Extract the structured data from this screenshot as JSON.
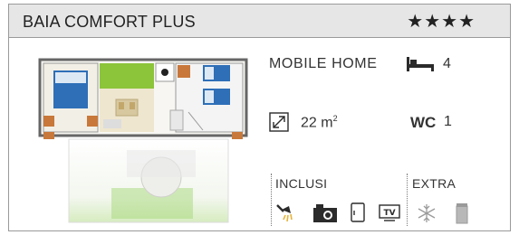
{
  "header": {
    "title": "BAIA COMFORT PLUS",
    "stars": "★★★★"
  },
  "info": {
    "category": "MOBILE HOME",
    "beds": "4",
    "size": "22 m",
    "size_unit_sup": "2",
    "wc_label": "WC",
    "wc_count": "1"
  },
  "included": {
    "label": "INCLUSI",
    "icons": [
      "shower-icon",
      "camera-icon",
      "fridge-icon",
      "tv-icon"
    ]
  },
  "extra": {
    "label": "EXTRA",
    "icons": [
      "air-conditioning-icon",
      "bin-icon"
    ]
  },
  "colors": {
    "header_bg": "#e6e6e6",
    "border": "#9a9a9a",
    "accent_bed": "#2e6fb7",
    "accent_kitchen": "#8cc43a"
  }
}
